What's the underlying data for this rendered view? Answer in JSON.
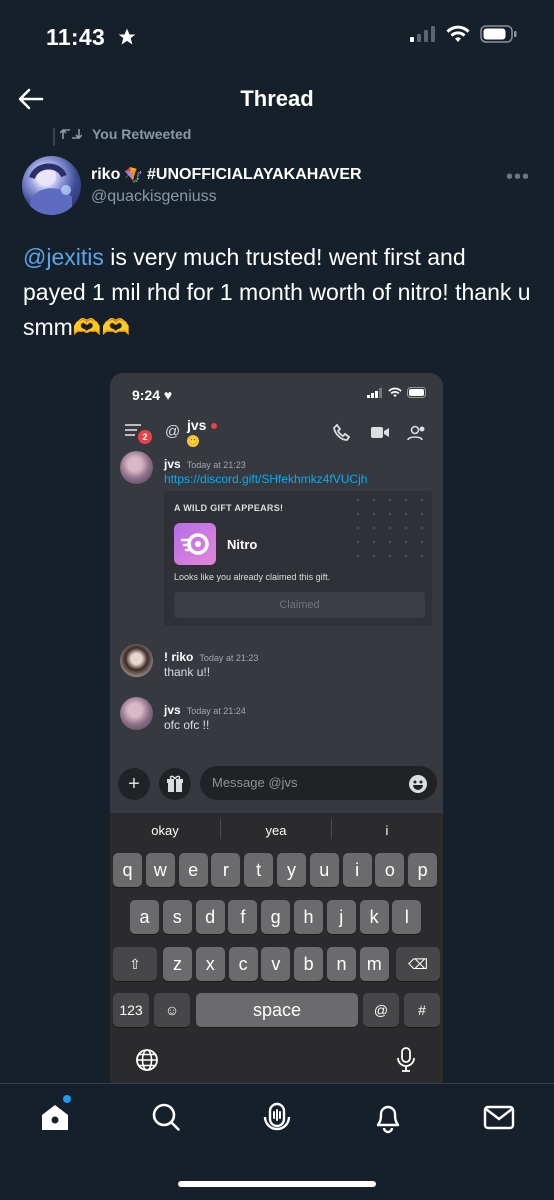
{
  "status_bar": {
    "time": "11:43"
  },
  "header": {
    "title": "Thread"
  },
  "retweet": {
    "label": "You Retweeted"
  },
  "tweet": {
    "display_name": "riko",
    "name_tag": "#UNOFFICIALAYAKAHAVER",
    "handle": "@quackisgeniuss",
    "mention": "@jexitis",
    "text_after_mention": " is very much trusted! went first and payed 1 mil rhd for 1 month worth of nitro! thank u smm",
    "emoji": "🫶🫶"
  },
  "embedded": {
    "time": "9:24",
    "badge": "2",
    "channel_user": "jvs",
    "messages": [
      {
        "author": "jvs",
        "time": "Today at 21:23",
        "link": "https://discord.gift/SHfekhmkz4fVUCjh"
      },
      {
        "author": "! riko",
        "time": "Today at 21:23",
        "text": "thank u!!"
      },
      {
        "author": "jvs",
        "time": "Today at 21:24",
        "text": "ofc ofc !!"
      }
    ],
    "gift": {
      "title": "A WILD GIFT APPEARS!",
      "name": "Nitro",
      "note": "Looks like you already claimed this gift.",
      "button": "Claimed"
    },
    "input_placeholder": "Message @jvs",
    "suggestions": [
      "okay",
      "yea",
      "i"
    ],
    "keyboard": {
      "row1": [
        "q",
        "w",
        "e",
        "r",
        "t",
        "y",
        "u",
        "i",
        "o",
        "p"
      ],
      "row2": [
        "a",
        "s",
        "d",
        "f",
        "g",
        "h",
        "j",
        "k",
        "l"
      ],
      "row3": [
        "z",
        "x",
        "c",
        "v",
        "b",
        "n",
        "m"
      ],
      "numbers": "123",
      "space": "space",
      "at": "@",
      "hash": "#"
    }
  },
  "colors": {
    "background": "#15202b",
    "mention": "#5aa6e8",
    "accent": "#1d9bf0"
  }
}
